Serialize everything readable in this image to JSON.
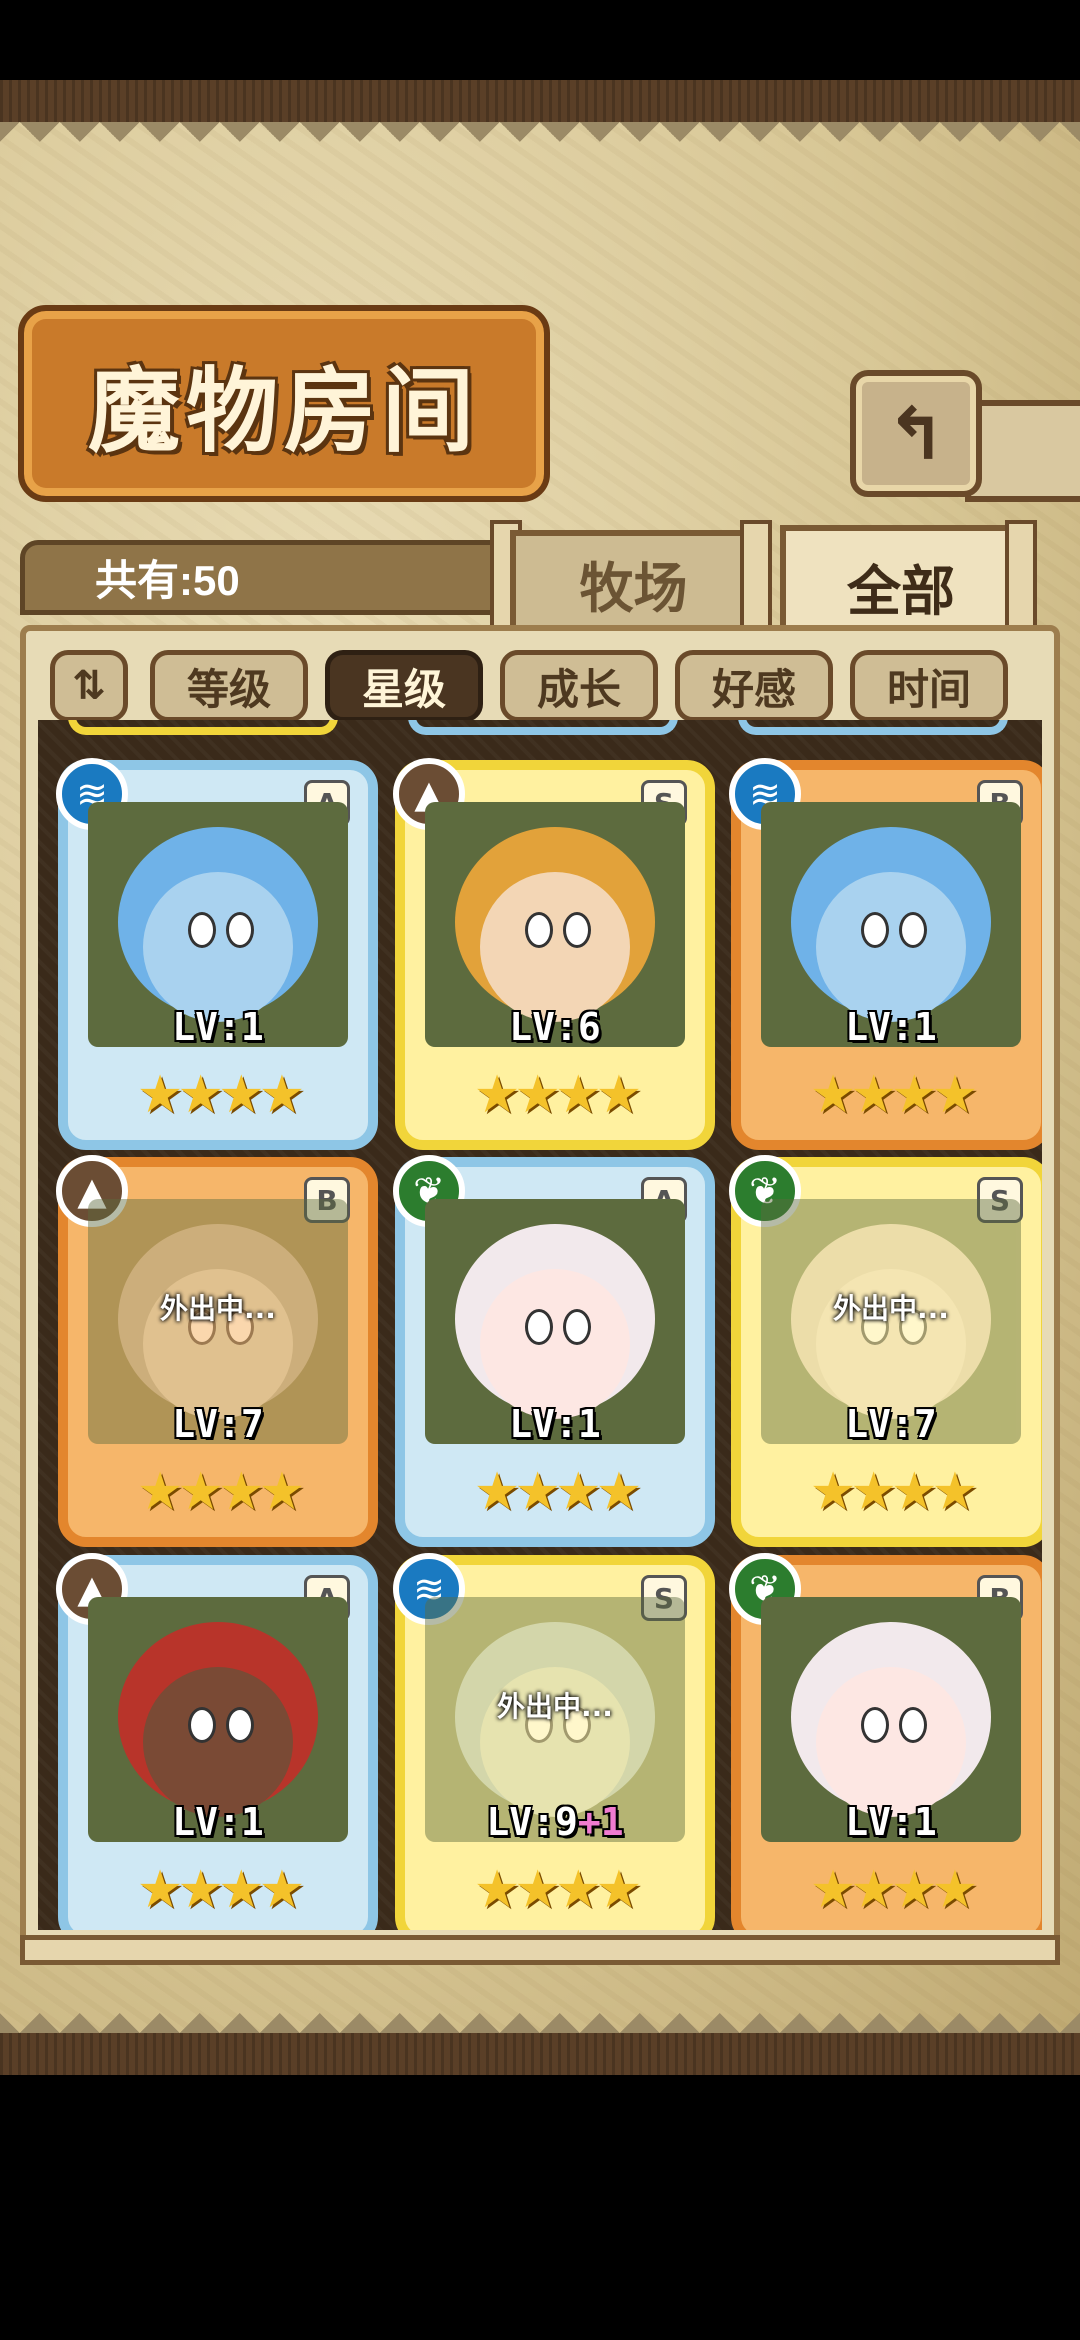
{
  "header": {
    "title": "魔物房间",
    "back_icon": "back-arrow-icon"
  },
  "summary": {
    "count_label": "共有:50"
  },
  "tabs": [
    {
      "label": "牧场",
      "active": false
    },
    {
      "label": "全部",
      "active": true
    }
  ],
  "filters": [
    {
      "label": "等级",
      "active": false
    },
    {
      "label": "星级",
      "active": true
    },
    {
      "label": "成长",
      "active": false
    },
    {
      "label": "好感",
      "active": false
    },
    {
      "label": "时间",
      "active": false
    }
  ],
  "sort_icon": "sort-toggle-icon",
  "away_text": "外出中...",
  "cards": [
    {
      "element": "water",
      "rank": "A",
      "frame": "blue",
      "level": "LV:1",
      "plus": "",
      "stars": "★★★★",
      "away": false,
      "skin": "#a9d2ef",
      "hair": "#6fb2e8"
    },
    {
      "element": "earth",
      "rank": "S",
      "frame": "gold",
      "level": "LV:6",
      "plus": "",
      "stars": "★★★★",
      "away": false,
      "skin": "#f3d6b5",
      "hair": "#e2a23a"
    },
    {
      "element": "water",
      "rank": "B",
      "frame": "orange",
      "level": "LV:1",
      "plus": "",
      "stars": "★★★★",
      "away": false,
      "skin": "#a9d2ef",
      "hair": "#6fb2e8"
    },
    {
      "element": "earth",
      "rank": "B",
      "frame": "orange",
      "level": "LV:7",
      "plus": "",
      "stars": "★★★★",
      "away": true,
      "skin": "#c7d0bd",
      "hair": "#9aa590"
    },
    {
      "element": "wood",
      "rank": "A",
      "frame": "blue",
      "level": "LV:1",
      "plus": "",
      "stars": "★★★★",
      "away": false,
      "skin": "#fde7e3",
      "hair": "#f2e9ec"
    },
    {
      "element": "wood",
      "rank": "S",
      "frame": "gold",
      "level": "LV:7",
      "plus": "",
      "stars": "★★★★",
      "away": true,
      "skin": "#e8d8c8",
      "hair": "#d6c7b5"
    },
    {
      "element": "earth",
      "rank": "A",
      "frame": "blue",
      "level": "LV:1",
      "plus": "",
      "stars": "★★★★",
      "away": false,
      "skin": "#7a4a35",
      "hair": "#b8342a"
    },
    {
      "element": "water",
      "rank": "S",
      "frame": "gold",
      "level": "LV:9",
      "plus": "+1",
      "stars": "★★★★",
      "away": true,
      "skin": "#c8d3c3",
      "hair": "#9fb7b7"
    },
    {
      "element": "wood",
      "rank": "B",
      "frame": "orange",
      "level": "LV:1",
      "plus": "",
      "stars": "★★★★",
      "away": false,
      "skin": "#fde7e3",
      "hair": "#f2e9ec"
    }
  ],
  "colors": {
    "frame_blue": "#8ec6e6",
    "frame_gold": "#f1d53a",
    "frame_orange": "#e3862d",
    "element_water": "#1a7ac1",
    "element_earth": "#6b4d34",
    "element_wood": "#2c7d2e"
  }
}
